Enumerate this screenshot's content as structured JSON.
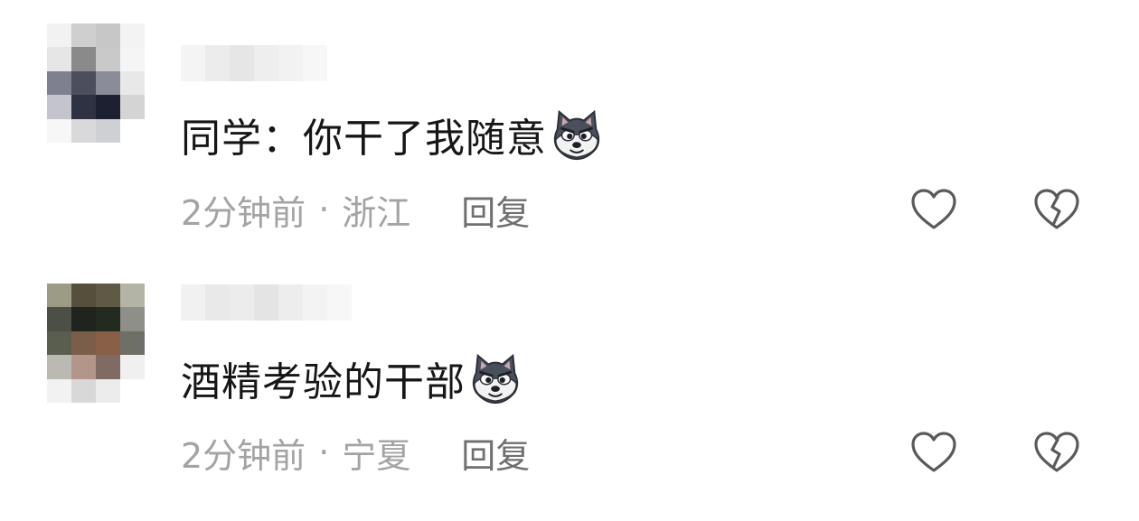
{
  "comments": [
    {
      "text": "同学：你干了我随意",
      "emoji": "wolf-face-emoji",
      "time": "2分钟前",
      "separator": "·",
      "location": "浙江",
      "reply_label": "回复",
      "like_icon": "heart-icon",
      "dislike_icon": "broken-heart-icon"
    },
    {
      "text": "酒精考验的干部",
      "emoji": "wolf-face-emoji",
      "time": "2分钟前",
      "separator": "·",
      "location": "宁夏",
      "reply_label": "回复",
      "like_icon": "heart-icon",
      "dislike_icon": "broken-heart-icon"
    }
  ],
  "colors": {
    "text": "#161616",
    "meta": "#a3a3a3",
    "reply": "#6f6f6f",
    "icon": "#5a5a5a",
    "emoji_fur": "#4a4f5c",
    "emoji_face": "#f2f2f2"
  },
  "avatars": [
    {
      "pixels": [
        "#f2f2f2",
        "#cfcfcf",
        "#c7c7c7",
        "#f3f3f3",
        "#e6e6e6",
        "#8a8a8a",
        "#c9c9c9",
        "#f5f5f5",
        "#7e8090",
        "#4c4e5d",
        "#8a8d99",
        "#e8e8e8",
        "#c4c5cc",
        "#2f3242",
        "#1d2030",
        "#d4d4d4",
        "#f7f7f7",
        "#d9d9dc",
        "#cfd0d4",
        "#ffffff"
      ]
    },
    {
      "pixels": [
        "#9c9c86",
        "#55503c",
        "#5f5a45",
        "#b3b3a6",
        "#4b4f45",
        "#1f241e",
        "#232a20",
        "#8e8f88",
        "#5a5e4f",
        "#7b5e4a",
        "#8a5f47",
        "#6e7066",
        "#bcb8b2",
        "#b2968a",
        "#806a64",
        "#f0f0f0",
        "#f2f2f2",
        "#d8d8d8",
        "#ececec",
        "#ffffff"
      ]
    }
  ],
  "name_blurs": [
    [
      "#f4f4f4",
      "#ececec",
      "#e6e6e6",
      "#eeeeee",
      "#f2f2f2",
      "#f7f7f7"
    ],
    [
      "#f1f1f1",
      "#e9e9e9",
      "#ececec",
      "#e4e4e4",
      "#ededed",
      "#f3f3f3",
      "#f7f7f7"
    ]
  ]
}
